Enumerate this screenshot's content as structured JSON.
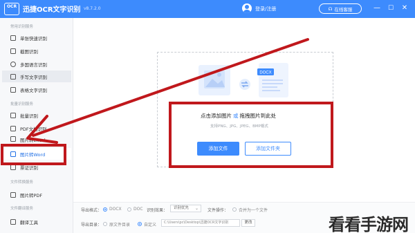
{
  "window": {
    "logo_text": "OCR",
    "title": "迅捷OCR文字识别",
    "version": "v8.7.2.0",
    "login_label": "登录/注册",
    "service_label": "在线客服",
    "minimize": "—",
    "maximize": "☐",
    "close": "✕"
  },
  "sidebar": {
    "sections": [
      {
        "label": "常用识别服务"
      },
      {
        "label": "批量识别服务"
      },
      {
        "label": "文件转换服务"
      },
      {
        "label": "文件翻译服务"
      }
    ],
    "items": [
      {
        "label": "单张快速识别",
        "icon": "scan-icon"
      },
      {
        "label": "截图识别",
        "icon": "crop-icon"
      },
      {
        "label": "多国语言识别",
        "icon": "globe-icon"
      },
      {
        "label": "手写文字识别",
        "icon": "pen-icon"
      },
      {
        "label": "表格文字识别",
        "icon": "table-icon"
      },
      {
        "label": "批量识别",
        "icon": "stack-icon"
      },
      {
        "label": "PDF文档识别",
        "icon": "pdf-icon"
      },
      {
        "label": "图片转Excel",
        "icon": "excel-icon"
      },
      {
        "label": "图片转Word",
        "icon": "word-icon"
      },
      {
        "label": "票证识别",
        "icon": "ticket-icon"
      },
      {
        "label": "图片转PDF",
        "icon": "image-pdf-icon"
      },
      {
        "label": "翻译工具",
        "icon": "translate-icon"
      }
    ]
  },
  "main": {
    "illustration_badge": "DOCX",
    "drop_title_a": "点击添加图片",
    "drop_title_sep": "或",
    "drop_title_b": "拖拽图片到此处",
    "drop_subtitle": "支持PNG、JPG、JPEG、BMP格式",
    "add_file": "添加文件",
    "add_folder": "添加文件夹"
  },
  "settings": {
    "export_format_label": "导出格式：",
    "format_docx": "DOCX",
    "format_doc": "DOC",
    "recognition_label": "识别效果：",
    "recognition_value": "识别优先",
    "file_merge_label": "文件操作：",
    "merge_option": "合并为一个文件",
    "export_dir_label": "导出目录：",
    "dir_original": "原文件目录",
    "dir_custom": "自定义",
    "path_value": "C:\\Users\\pc\\Desktop\\迅捷OCR文字识别",
    "change_button": "更改"
  },
  "watermark": "看看手游网",
  "colors": {
    "accent": "#3d8bfd",
    "highlight_red": "#c0181c"
  }
}
